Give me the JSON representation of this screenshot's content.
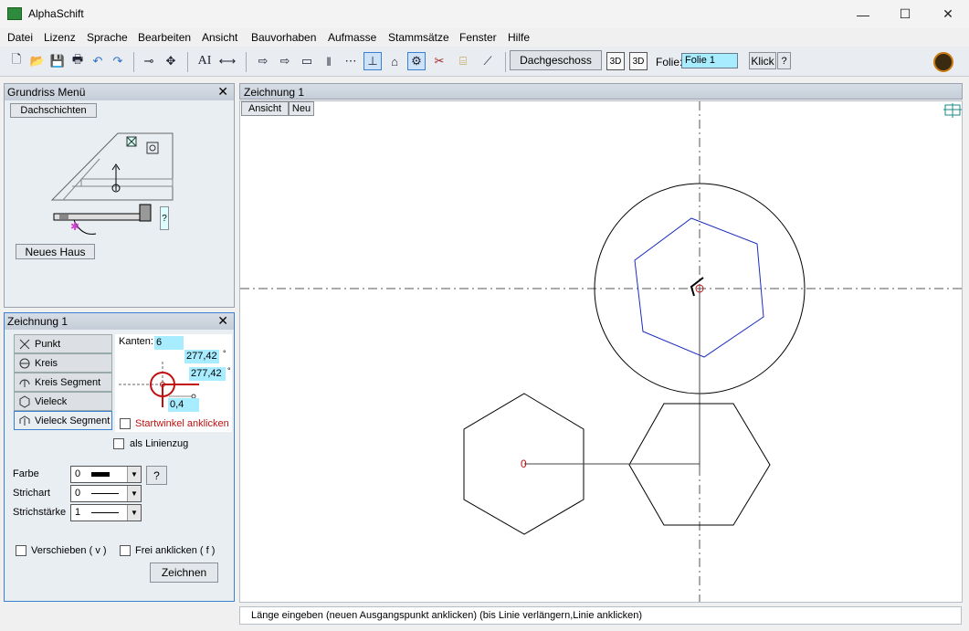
{
  "window": {
    "title": "AlphaSchift",
    "min": "—",
    "max": "☐",
    "close": "✕"
  },
  "menu": [
    "Datei",
    "Lizenz",
    "Sprache",
    "Bearbeiten",
    "Ansicht",
    "Bauvorhaben",
    "Aufmasse",
    "Stammsätze",
    "Fenster",
    "Hilfe"
  ],
  "toolbar": {
    "floor": "Dachgeschoss",
    "btn3d_a": "3D",
    "btn3d_b": "3D",
    "folie_label": "Folie:",
    "folie_value": "Folie 1",
    "klick": "Klick",
    "help": "?",
    "text_tool": "AI"
  },
  "grundriss": {
    "title": "Grundriss Menü",
    "close": "✕",
    "tab": "Dachschichten",
    "new_house": "Neues Haus",
    "help": "?"
  },
  "zeichnung_panel": {
    "title": "Zeichnung 1",
    "close": "✕",
    "shapes": [
      "Punkt",
      "Kreis",
      "Kreis Segment",
      "Vieleck",
      "Vieleck Segment"
    ],
    "kanten_label": "Kanten:",
    "kanten_value": "6",
    "angle1": "277,42",
    "angle2": "277,42",
    "degree": "°",
    "length": "0,4",
    "startwinkel": "Startwinkel anklicken",
    "als_linienzug": "als Linienzug",
    "farbe_label": "Farbe",
    "farbe_value": "0",
    "farbe_help": "?",
    "strichart_label": "Strichart",
    "strichart_value": "0",
    "strichstaerke_label": "Strichstärke",
    "strichstaerke_value": "1",
    "verschieben": "Verschieben ( v )",
    "frei": "Frei anklicken ( f )",
    "draw_button": "Zeichnen"
  },
  "drawing": {
    "title": "Zeichnung 1",
    "tab_ansicht": "Ansicht",
    "tab_neu": "Neu",
    "point_label": "0"
  },
  "status": "Länge eingeben  (neuen Ausgangspunkt anklicken) (bis Linie verlängern,Linie anklicken)"
}
